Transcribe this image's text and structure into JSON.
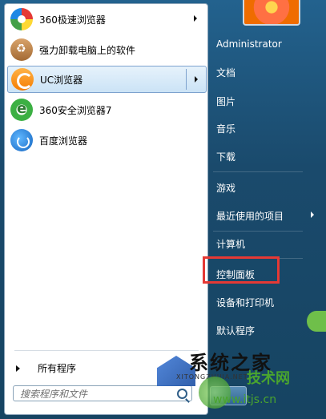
{
  "programs": [
    {
      "label": "360极速浏览器",
      "icon": "360-browser-icon",
      "has_submenu": true
    },
    {
      "label": "强力卸载电脑上的软件",
      "icon": "uninstall-box-icon",
      "has_submenu": false
    },
    {
      "label": "UC浏览器",
      "icon": "uc-browser-icon",
      "has_submenu": true,
      "selected": true
    },
    {
      "label": "360安全浏览器7",
      "icon": "360-safe-browser-icon",
      "has_submenu": false
    },
    {
      "label": "百度浏览器",
      "icon": "baidu-browser-icon",
      "has_submenu": false
    }
  ],
  "all_programs": "所有程序",
  "search": {
    "placeholder": "搜索程序和文件"
  },
  "right_menu": {
    "user": "Administrator",
    "documents": "文档",
    "pictures": "图片",
    "music": "音乐",
    "downloads": "下载",
    "games": "游戏",
    "recent": "最近使用的项目",
    "computer": "计算机",
    "control_panel": "控制面板",
    "devices": "设备和打印机",
    "default_programs": "默认程序"
  },
  "watermark": {
    "title": "系统之家",
    "subtitle": "XITONGZHIJIA.NET",
    "site": "技术网",
    "url": "www.itjs.cn"
  },
  "colors": {
    "highlight_box": "#e53935",
    "selected_bg": "#cbe3f6"
  }
}
